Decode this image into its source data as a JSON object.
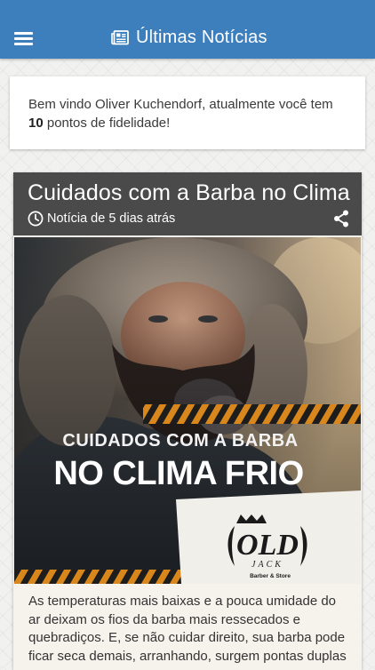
{
  "appbar": {
    "title": "Últimas Notícias",
    "color": "#3d7fbd"
  },
  "welcome": {
    "prefix": "Bem vindo Oliver Kuchendorf, atualmente você tem ",
    "points": "10",
    "suffix": " pontos de fidelidade!"
  },
  "news": {
    "title": "Cuidados com a Barba no Clima",
    "meta": "Notícia de 5 dias atrás",
    "image": {
      "headline_line1": "CUIDADOS COM A BARBA",
      "headline_line2": "NO CLIMA FRIO",
      "logo_line1": "OLD",
      "logo_line2": "JACK",
      "logo_tagline": "Barber & Store"
    },
    "body": "As temperaturas mais baixas e a pouca umidade do ar deixam os fios da barba mais ressecados e quebradiços. E, se não cuidar direito, sua barba pode ficar seca demais, arranhando, surgem pontas duplas e"
  }
}
